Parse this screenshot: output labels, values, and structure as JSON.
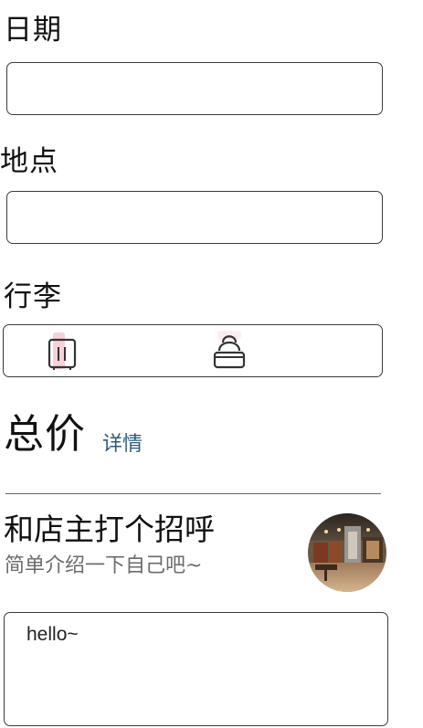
{
  "form": {
    "date_label": "日期",
    "date_value": "",
    "location_label": "地点",
    "location_value": "",
    "luggage_label": "行李",
    "luggage_options": [
      {
        "icon": "suitcase-icon",
        "selected": true
      },
      {
        "icon": "backpack-icon",
        "selected": false
      }
    ]
  },
  "total": {
    "label": "总价",
    "detail_link": "详情"
  },
  "greeting": {
    "title": "和店主打个招呼",
    "subtitle": "简单介绍一下自己吧~",
    "message": "hello~"
  },
  "colors": {
    "link": "#2c5a7e",
    "border": "#3a3a3a",
    "suitcase_highlight": "#f6c9d4"
  }
}
